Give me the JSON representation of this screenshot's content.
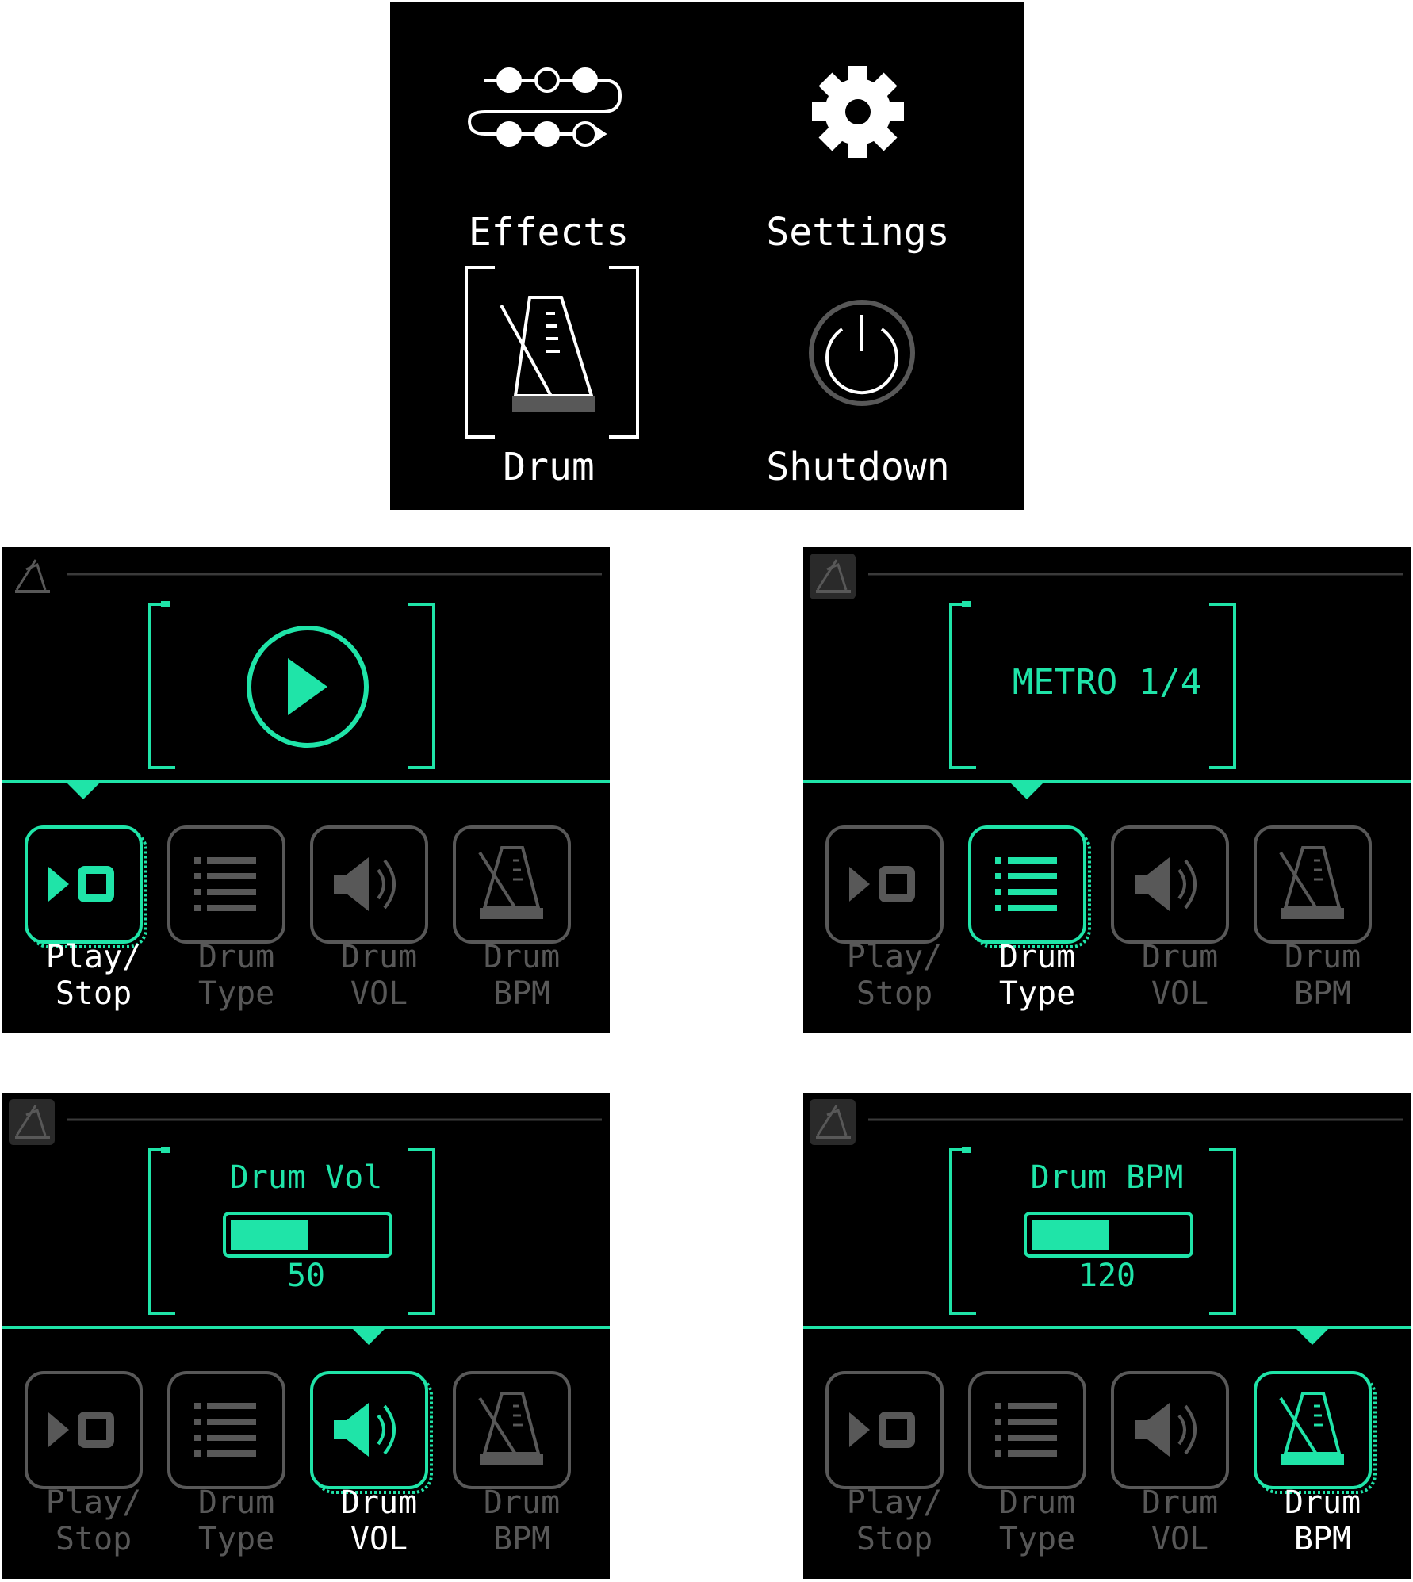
{
  "colors": {
    "accent": "#1fe4a8",
    "inactive": "#585858",
    "text": "#ffffff",
    "background": "#000000"
  },
  "main_menu": {
    "items": [
      {
        "label": "Effects",
        "icon": "effects-chain-icon"
      },
      {
        "label": "Settings",
        "icon": "gear-icon"
      },
      {
        "label": "Drum",
        "icon": "metronome-icon",
        "selected": true
      },
      {
        "label": "Shutdown",
        "icon": "power-icon"
      }
    ]
  },
  "drum_screens": [
    {
      "header_icon": "metronome-small-icon",
      "panel": {
        "type": "play-button",
        "icon": "play-icon"
      },
      "selected_tab": 0,
      "tabs": [
        {
          "label": "Play/\nStop",
          "icon": "play-stop-icon"
        },
        {
          "label": "Drum\nType",
          "icon": "list-icon"
        },
        {
          "label": "Drum\nVOL",
          "icon": "speaker-icon"
        },
        {
          "label": "Drum\nBPM",
          "icon": "metronome-icon"
        }
      ]
    },
    {
      "header_icon": "metronome-small-icon",
      "panel": {
        "type": "text",
        "value": "METRO 1/4"
      },
      "selected_tab": 1,
      "tabs": [
        {
          "label": "Play/\nStop",
          "icon": "play-stop-icon"
        },
        {
          "label": "Drum\nType",
          "icon": "list-icon"
        },
        {
          "label": "Drum\nVOL",
          "icon": "speaker-icon"
        },
        {
          "label": "Drum\nBPM",
          "icon": "metronome-icon"
        }
      ]
    },
    {
      "header_icon": "metronome-small-icon",
      "panel": {
        "type": "slider",
        "title": "Drum Vol",
        "value": "50",
        "level_fraction": 0.5
      },
      "selected_tab": 2,
      "tabs": [
        {
          "label": "Play/\nStop",
          "icon": "play-stop-icon"
        },
        {
          "label": "Drum\nType",
          "icon": "list-icon"
        },
        {
          "label": "Drum\nVOL",
          "icon": "speaker-icon"
        },
        {
          "label": "Drum\nBPM",
          "icon": "metronome-icon"
        }
      ]
    },
    {
      "header_icon": "metronome-small-icon",
      "panel": {
        "type": "slider",
        "title": "Drum BPM",
        "value": "120",
        "level_fraction": 0.5
      },
      "selected_tab": 3,
      "tabs": [
        {
          "label": "Play/\nStop",
          "icon": "play-stop-icon"
        },
        {
          "label": "Drum\nType",
          "icon": "list-icon"
        },
        {
          "label": "Drum\nVOL",
          "icon": "speaker-icon"
        },
        {
          "label": "Drum\nBPM",
          "icon": "metronome-icon"
        }
      ]
    }
  ]
}
